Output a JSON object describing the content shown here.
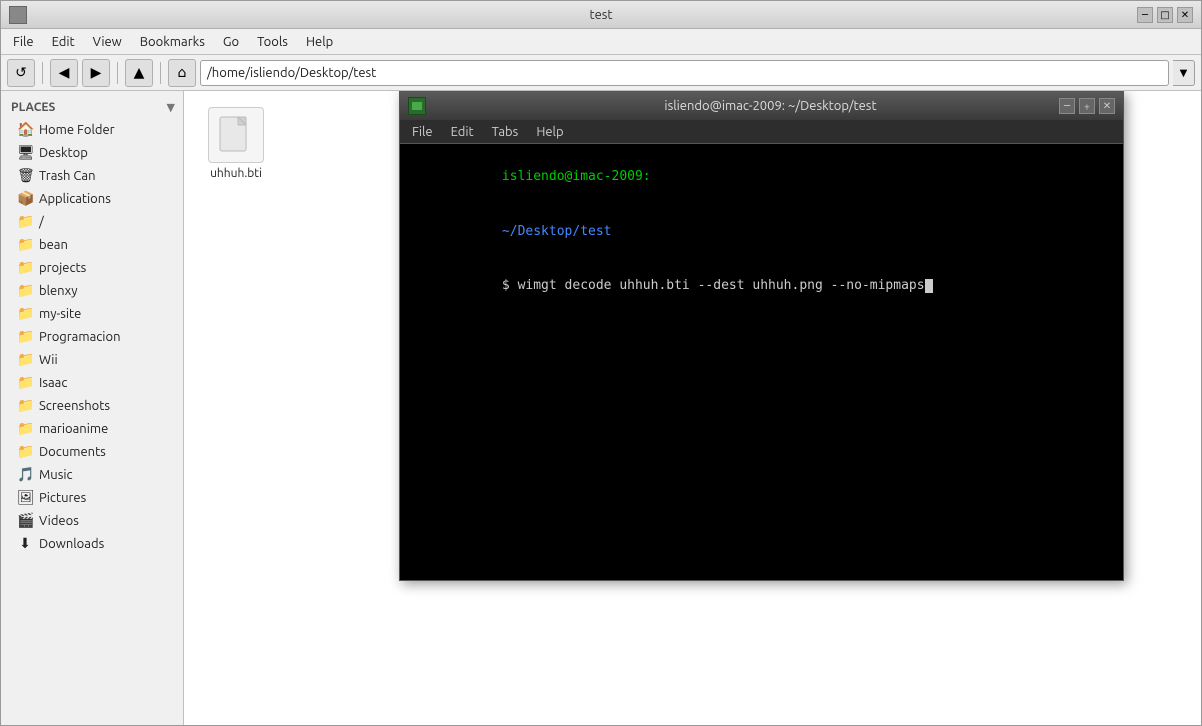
{
  "window": {
    "title": "test",
    "icon": "folder-icon"
  },
  "menubar": {
    "items": [
      "File",
      "Edit",
      "View",
      "Bookmarks",
      "Go",
      "Tools",
      "Help"
    ]
  },
  "toolbar": {
    "back_btn": "◀",
    "forward_btn": "▶",
    "up_btn": "▲",
    "home_btn": "⌂",
    "location": "/home/isliendo/Desktop/test",
    "dropdown": "▼"
  },
  "sidebar": {
    "header": "Places",
    "items": [
      {
        "label": "Home Folder",
        "icon": "🏠"
      },
      {
        "label": "Desktop",
        "icon": "🖥"
      },
      {
        "label": "Trash Can",
        "icon": "🗑"
      },
      {
        "label": "Applications",
        "icon": "📦"
      },
      {
        "label": "/",
        "icon": "📁"
      },
      {
        "label": "bean",
        "icon": "📁"
      },
      {
        "label": "projects",
        "icon": "📁"
      },
      {
        "label": "blenxy",
        "icon": "📁"
      },
      {
        "label": "my-site",
        "icon": "📁"
      },
      {
        "label": "Programacion",
        "icon": "📁"
      },
      {
        "label": "Wii",
        "icon": "📁"
      },
      {
        "label": "Isaac",
        "icon": "📁"
      },
      {
        "label": "Screenshots",
        "icon": "📁"
      },
      {
        "label": "marioanime",
        "icon": "📁"
      },
      {
        "label": "Documents",
        "icon": "📁"
      },
      {
        "label": "Music",
        "icon": "🎵"
      },
      {
        "label": "Pictures",
        "icon": "🖼"
      },
      {
        "label": "Videos",
        "icon": "🎬"
      },
      {
        "label": "Downloads",
        "icon": "⬇"
      }
    ]
  },
  "file_area": {
    "files": [
      {
        "name": "uhhuh.bti",
        "type": "file"
      }
    ]
  },
  "terminal": {
    "title": "isliendo@imac-2009: ~/Desktop/test",
    "icon": "terminal-icon",
    "menubar": [
      "File",
      "Edit",
      "Tabs",
      "Help"
    ],
    "line1_user": "isliendo@imac-2009:",
    "line1_path": "~/Desktop/test",
    "line2_prompt": "$ wimgt decode uhhuh.bti --dest uhhuh.png --no-mipmaps"
  }
}
